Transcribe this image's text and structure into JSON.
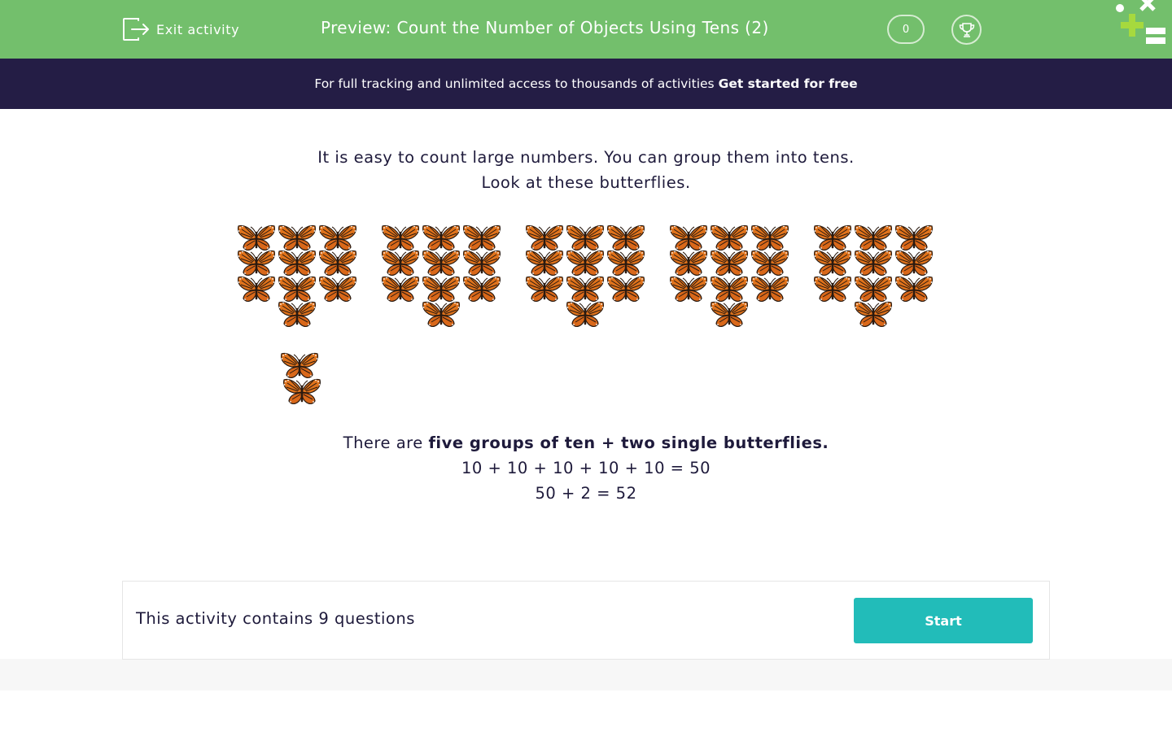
{
  "header": {
    "exit_label": "Exit activity",
    "title": "Preview: Count the Number of Objects Using Tens (2)",
    "score": "0",
    "icons": {
      "exit": "exit-icon",
      "trophy": "trophy-icon",
      "logo": "math-symbols-logo"
    },
    "colors": {
      "bar": "#73bf6c",
      "logo_green": "#a6d93e"
    }
  },
  "banner": {
    "text": "For full tracking and unlimited access to thousands of activities",
    "link": "Get started for free",
    "color": "#241d45"
  },
  "content": {
    "intro_line1": "It is easy to count large numbers. You can group them into tens.",
    "intro_line2": "Look at these butterflies.",
    "groups_of_ten": 5,
    "single_butterflies": 2,
    "explain_prefix": "There are",
    "explain_bold": "five groups of ten + two single butterflies.",
    "sum_line": "10 + 10 + 10 + 10 + 10 = 50",
    "total_line": "50 + 2 = 52"
  },
  "footer": {
    "question_count_text": "This activity contains 9 questions",
    "start_label": "Start",
    "button_color": "#22bcb9"
  }
}
